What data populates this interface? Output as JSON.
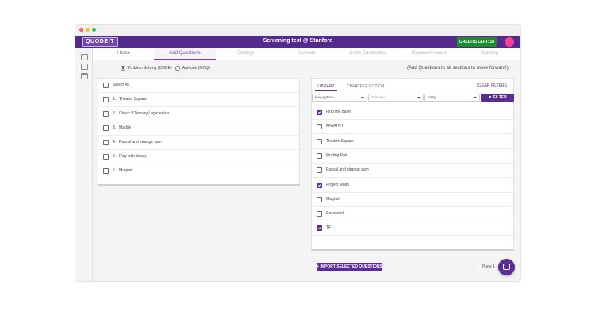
{
  "app": {
    "logo": "QUODEIT",
    "title": "Screening test @ Stanford",
    "credits": "CREDITS LEFT: 18"
  },
  "tabs": [
    {
      "label": "Home"
    },
    {
      "label": "Add Questions"
    },
    {
      "label": "Settings"
    },
    {
      "label": "Activate"
    },
    {
      "label": "Invite Candidates"
    },
    {
      "label": "Review Answers"
    },
    {
      "label": "Ranking"
    }
  ],
  "question_type": {
    "options": [
      "Problem Solving (CODE)",
      "Aptitude (MCQ)"
    ],
    "selected": "Problem Solving (CODE)"
  },
  "hint": "(Add Questions to all sections to move forward!)",
  "selected_list": {
    "select_all": "Select All",
    "items": [
      {
        "num": "1.",
        "title": "Theatre Square"
      },
      {
        "num": "2.",
        "title": "Check if Ternary Logic exists"
      },
      {
        "num": "3.",
        "title": "Marble"
      },
      {
        "num": "4.",
        "title": "Pascal and strange sum"
      },
      {
        "num": "5.",
        "title": "Play with binary"
      },
      {
        "num": "6.",
        "title": "Magnet"
      }
    ]
  },
  "library": {
    "tabs": [
      "LIBRARY",
      "CREATE QUESTION"
    ],
    "clear_filters": "CLEAR FILTERS",
    "filters": {
      "language": "lang-python",
      "subtopic_placeholder": "Subtopic",
      "difficulty": "Easy",
      "filter_button": "FILTER"
    },
    "items": [
      {
        "title": "Find the Base",
        "checked": true
      },
      {
        "title": "FPARITH",
        "checked": false
      },
      {
        "title": "Theatre Square",
        "checked": false
      },
      {
        "title": "Finding Pair",
        "checked": false
      },
      {
        "title": "Pascal and strange sum",
        "checked": false
      },
      {
        "title": "Project Team",
        "checked": true
      },
      {
        "title": "Magnet",
        "checked": false
      },
      {
        "title": "Password",
        "checked": false
      },
      {
        "title": "TF",
        "checked": true
      }
    ],
    "import_button": "IMPORT SELECTED QUESTIONS",
    "pagination": {
      "prev": "‹",
      "label": "Page 1",
      "next": "›"
    }
  },
  "colors": {
    "brand": "#542a8d",
    "accent": "#5a2d91",
    "credits": "#19912b",
    "avatar": "#ff3e97"
  }
}
